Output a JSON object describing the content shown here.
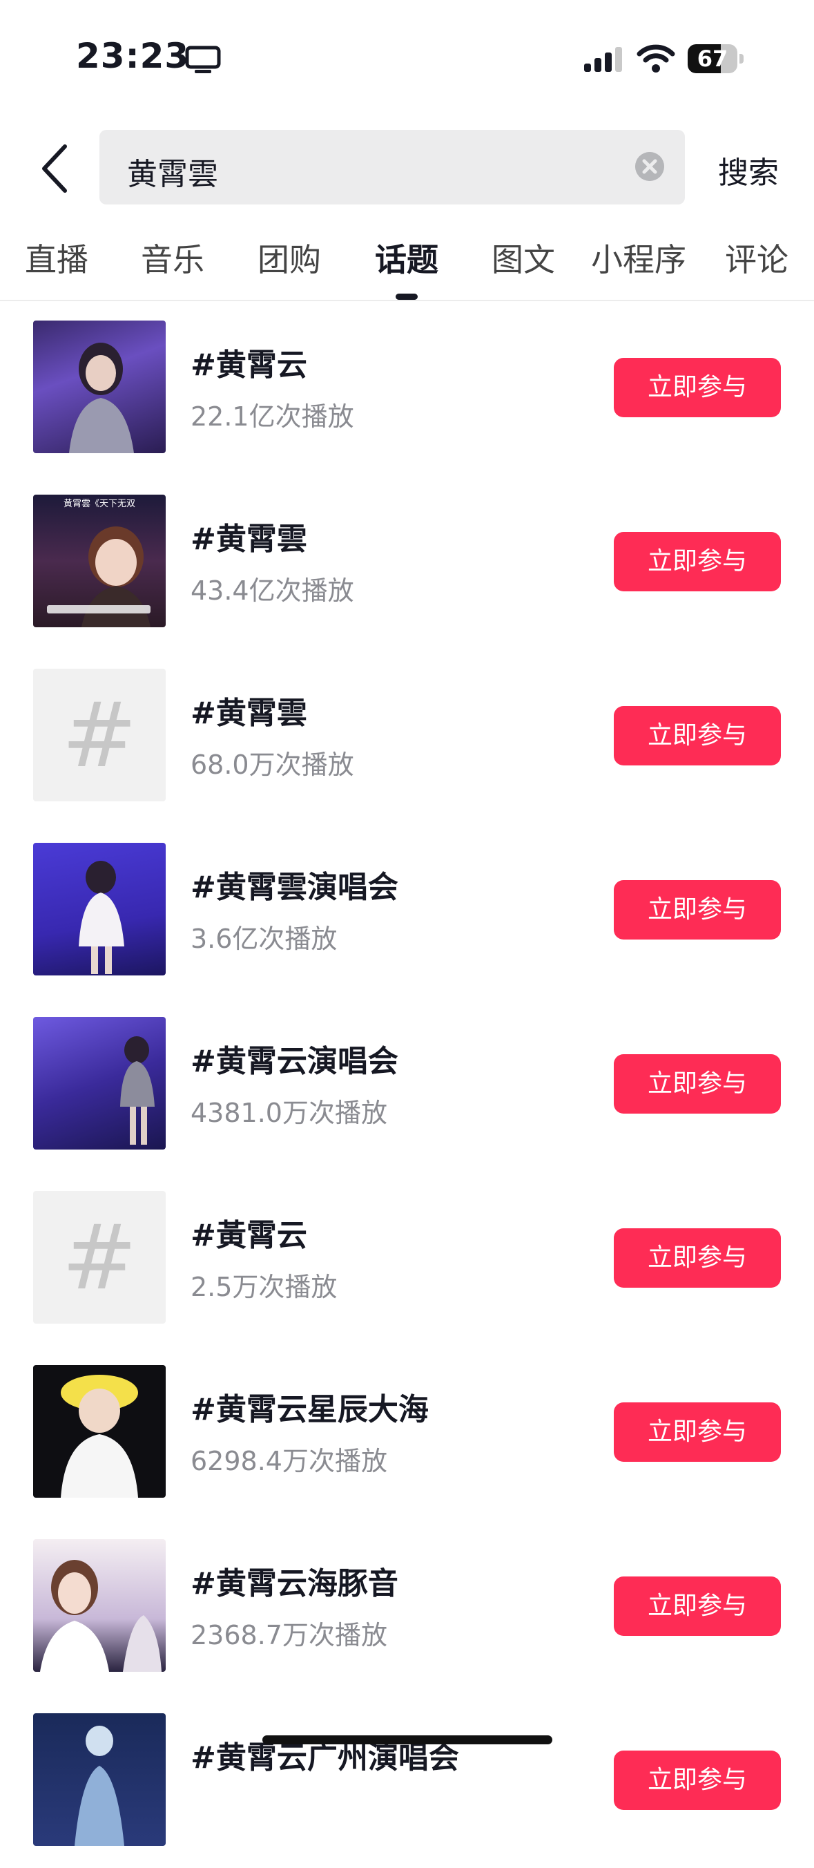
{
  "status_bar": {
    "time": "23:23",
    "battery": "67",
    "battery_level": 0.67
  },
  "search": {
    "query": "黄霄雲",
    "submit_label": "搜索"
  },
  "tabs": [
    {
      "label": "直播"
    },
    {
      "label": "音乐"
    },
    {
      "label": "团购"
    },
    {
      "label": "话题",
      "active": true
    },
    {
      "label": "图文"
    },
    {
      "label": "小程序"
    },
    {
      "label": "评论"
    }
  ],
  "colors": {
    "accent": "#fe2c55",
    "text": "#161823",
    "subtext": "#8a8b91"
  },
  "topics": [
    {
      "title": "#黄霄云",
      "plays": "22.1亿次播放",
      "button": "立即参与",
      "thumb": "photo"
    },
    {
      "title": "#黄霄雲",
      "plays": "43.4亿次播放",
      "button": "立即参与",
      "thumb": "photo",
      "thumb_caption": "黄霄雲《天下无双"
    },
    {
      "title": "#黄霄雲",
      "plays": "68.0万次播放",
      "button": "立即参与",
      "thumb": "hash",
      "thumb_symbol": "#"
    },
    {
      "title": "#黄霄雲演唱会",
      "plays": "3.6亿次播放",
      "button": "立即参与",
      "thumb": "photo"
    },
    {
      "title": "#黄霄云演唱会",
      "plays": "4381.0万次播放",
      "button": "立即参与",
      "thumb": "photo"
    },
    {
      "title": "#黃霄云",
      "plays": "2.5万次播放",
      "button": "立即参与",
      "thumb": "hash",
      "thumb_symbol": "#"
    },
    {
      "title": "#黄霄云星辰大海",
      "plays": "6298.4万次播放",
      "button": "立即参与",
      "thumb": "photo"
    },
    {
      "title": "#黄霄云海豚音",
      "plays": "2368.7万次播放",
      "button": "立即参与",
      "thumb": "photo"
    },
    {
      "title": "#黄霄云广州演唱会",
      "plays": "",
      "button": "立即参与",
      "thumb": "photo"
    }
  ]
}
